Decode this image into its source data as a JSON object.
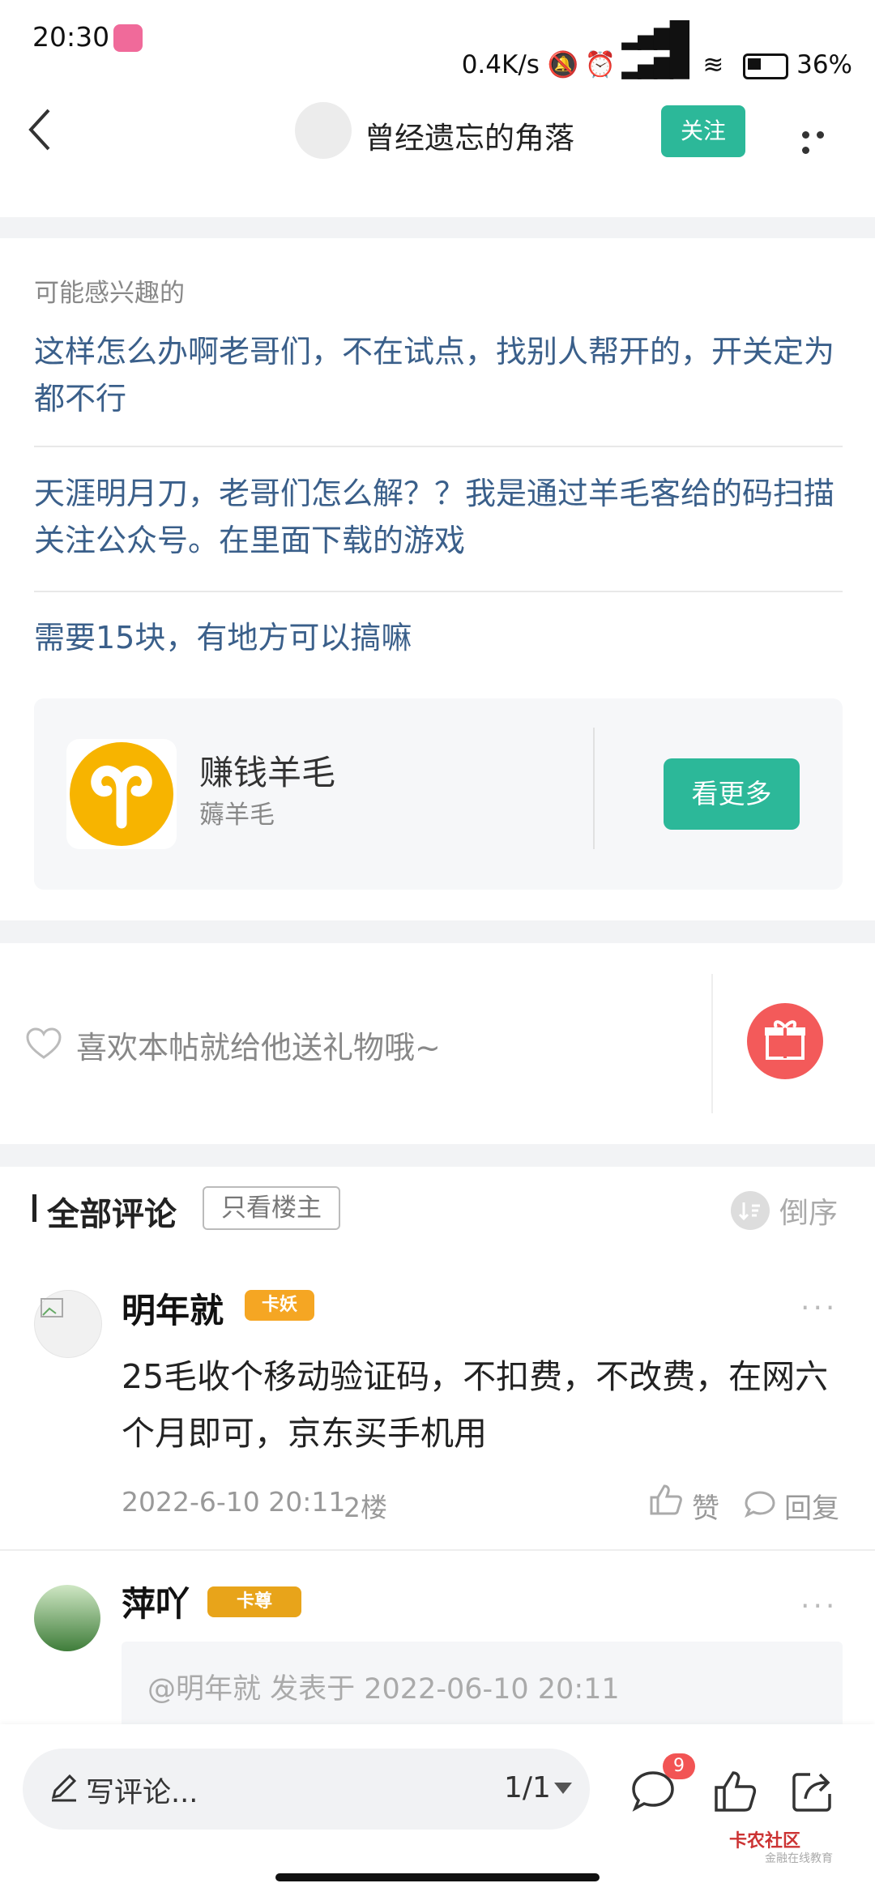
{
  "status_bar": {
    "time": "20:30",
    "net_speed": "0.4K/s",
    "battery": "36%"
  },
  "header": {
    "author": "曾经遗忘的角落",
    "follow_label": "关注"
  },
  "related": {
    "label": "可能感兴趣的",
    "items": [
      "这样怎么办啊老哥们，不在试点，找别人帮开的，开关定为都不行",
      "天涯明月刀，老哥们怎么解？？我是通过羊毛客给的码扫描关注公众号。在里面下载的游戏",
      "需要15块，有地方可以搞嘛"
    ]
  },
  "card": {
    "title": "赚钱羊毛",
    "subtitle": "薅羊毛",
    "button": "看更多"
  },
  "gift": {
    "text": "喜欢本帖就给他送礼物哦~"
  },
  "comments_header": {
    "title": "全部评论",
    "only_host": "只看楼主",
    "sort": "倒序"
  },
  "comments": [
    {
      "name": "明年就",
      "badge": "卡妖",
      "text": "25毛收个移动验证码，不扣费，不改费，在网六个月即可，京东买手机用",
      "date": "2022-6-10 20:11",
      "floor": "2楼",
      "like_label": "赞",
      "reply_label": "回复",
      "more": "···"
    },
    {
      "name": "萍吖",
      "badge": "卡尊",
      "more": "···",
      "quote": "@明年就 发表于 2022-06-10 20:11"
    }
  ],
  "bottom_bar": {
    "placeholder": "写评论...",
    "pager": "1/1",
    "comment_count": "9"
  },
  "watermark": {
    "title": "卡农社区",
    "subtitle": "金融在线教育"
  },
  "colors": {
    "accent": "#2cb899",
    "link": "#3a5f8a",
    "gift": "#f35a5a",
    "notify": "#f25454"
  }
}
